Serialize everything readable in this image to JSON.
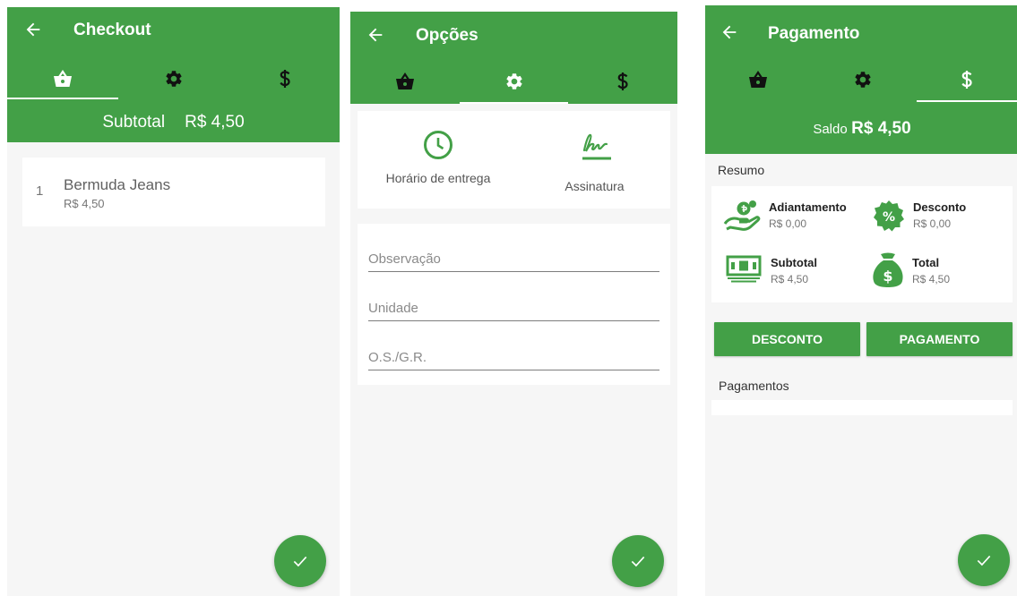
{
  "colors": {
    "primary": "#43a047",
    "background": "#f6f6f6",
    "card": "#ffffff"
  },
  "checkout": {
    "title": "Checkout",
    "tabs": [
      {
        "icon": "basket-icon",
        "selected": true
      },
      {
        "icon": "gear-icon",
        "selected": false
      },
      {
        "icon": "dollar-icon",
        "selected": false
      }
    ],
    "subtotal_label": "Subtotal",
    "subtotal_value": "R$ 4,50",
    "items": [
      {
        "quantity": "1",
        "name": "Bermuda Jeans",
        "price": "R$ 4,50"
      }
    ],
    "fab_icon": "check-icon"
  },
  "opcoes": {
    "title": "Opções",
    "tabs": [
      {
        "icon": "basket-icon",
        "selected": false
      },
      {
        "icon": "gear-icon",
        "selected": true
      },
      {
        "icon": "dollar-icon",
        "selected": false
      }
    ],
    "delivery_time_label": "Horário de entrega",
    "signature_label": "Assinatura",
    "fields": {
      "observation_placeholder": "Observação",
      "unit_placeholder": "Unidade",
      "os_placeholder": "O.S./G.R."
    },
    "fab_icon": "check-icon"
  },
  "pagamento": {
    "title": "Pagamento",
    "tabs": [
      {
        "icon": "basket-icon",
        "selected": false
      },
      {
        "icon": "gear-icon",
        "selected": false
      },
      {
        "icon": "dollar-icon",
        "selected": true
      }
    ],
    "balance_label": "Saldo",
    "balance_value": "R$ 4,50",
    "summary_title": "Resumo",
    "summary": {
      "advance_label": "Adiantamento",
      "advance_value": "R$ 0,00",
      "discount_label": "Desconto",
      "discount_value": "R$ 0,00",
      "subtotal_label": "Subtotal",
      "subtotal_value": "R$ 4,50",
      "total_label": "Total",
      "total_value": "R$ 4,50"
    },
    "discount_button": "DESCONTO",
    "payment_button": "PAGAMENTO",
    "payments_title": "Pagamentos",
    "fab_icon": "check-icon"
  }
}
